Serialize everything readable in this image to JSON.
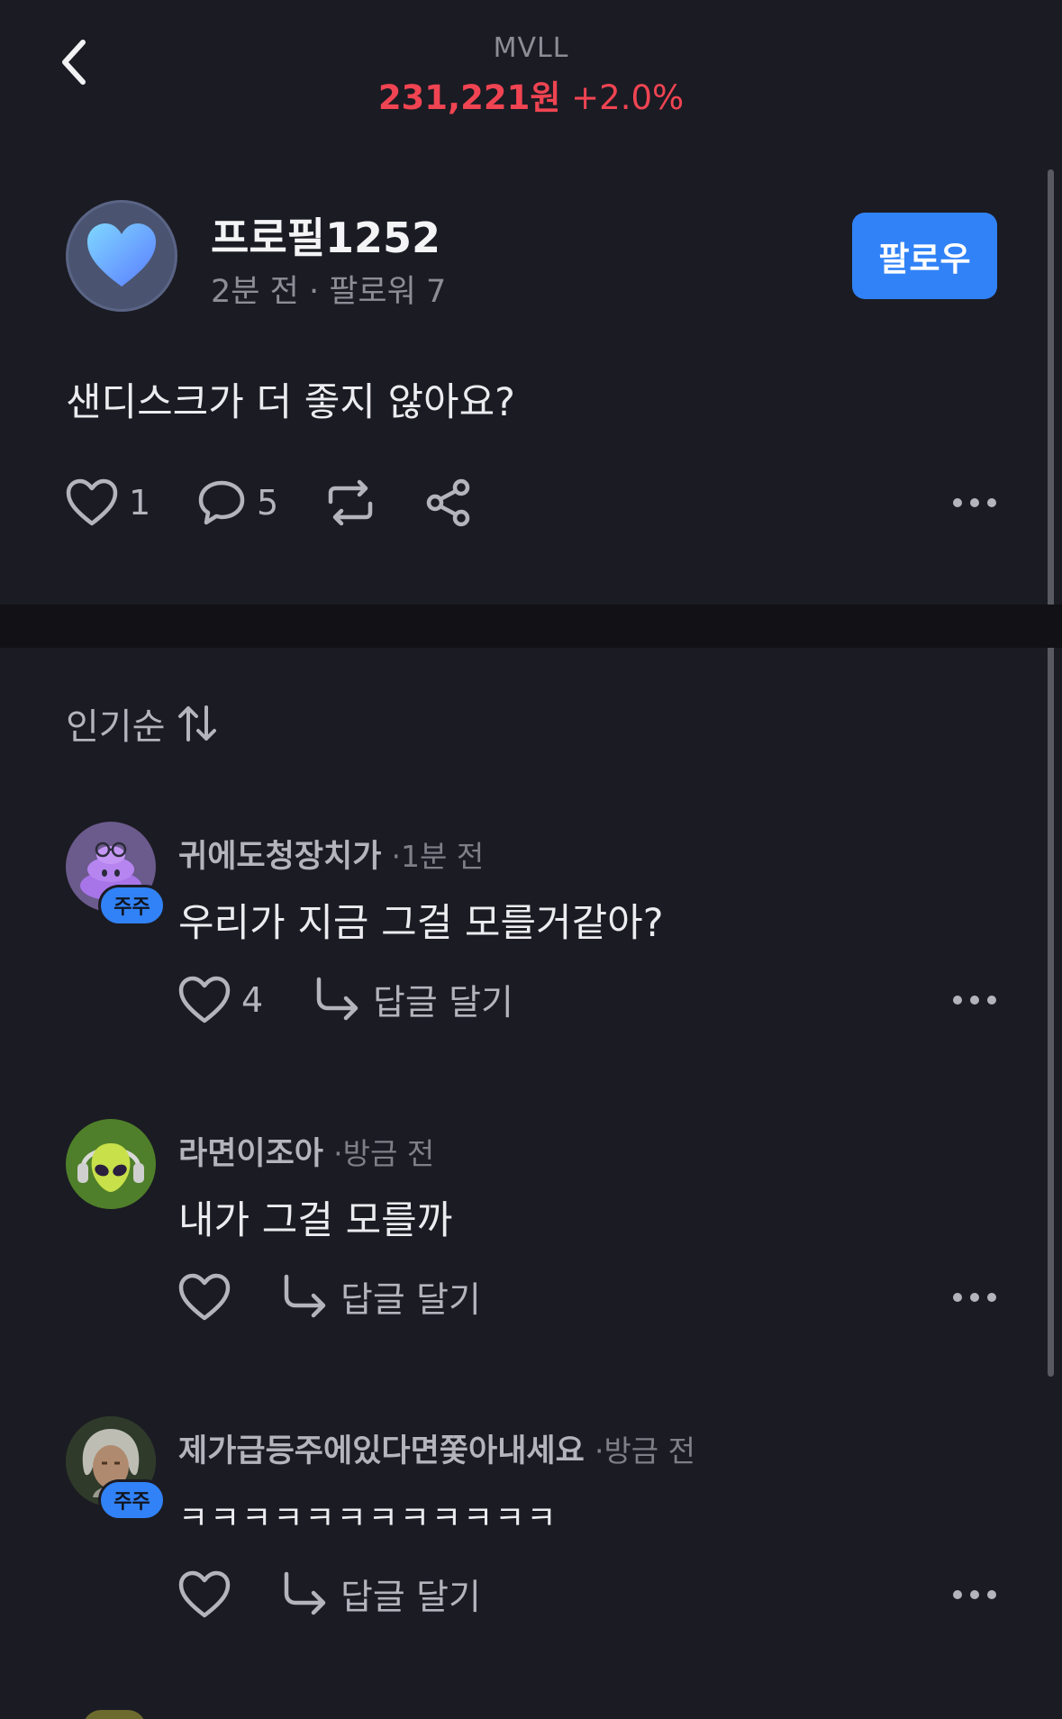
{
  "header": {
    "ticker": "MVLL",
    "price": "231,221원",
    "change": "+2.0%",
    "price_color": "#f04452"
  },
  "post": {
    "author": "프로필1252",
    "time": "2분 전",
    "meta_separator": "·",
    "followers": "팔로워 7",
    "follow_label": "팔로우",
    "text": "샌디스크가 더 좋지 않아요?",
    "like_count": "1",
    "comment_count": "5",
    "avatar_icon": "blue-heart-icon"
  },
  "sort": {
    "label": "인기순",
    "icon": "sort-arrows-icon"
  },
  "comments": [
    {
      "name": "귀에도청장치가",
      "time": "·1분 전",
      "text": "우리가 지금 그걸 모를거같아?",
      "likes": "4",
      "reply_label": "답글 달기",
      "badge": "주주",
      "avatar_icon": "purple-poop-glasses-icon"
    },
    {
      "name": "라면이조아",
      "time": "·방금 전",
      "text": "내가 그걸 모를까",
      "likes": "",
      "reply_label": "답글 달기",
      "badge": "",
      "avatar_icon": "alien-headphones-icon"
    },
    {
      "name": "제가급등주에있다면쫓아내세요",
      "time": "·방금 전",
      "text": "ㅋㅋㅋㅋㅋㅋㅋㅋㅋㅋㅋㅋ",
      "likes": "",
      "reply_label": "답글 달기",
      "badge": "주주",
      "avatar_icon": "person-photo-icon"
    }
  ],
  "colors": {
    "background": "#1b1b23",
    "accent": "#3182f6",
    "muted": "#8d8d96"
  }
}
